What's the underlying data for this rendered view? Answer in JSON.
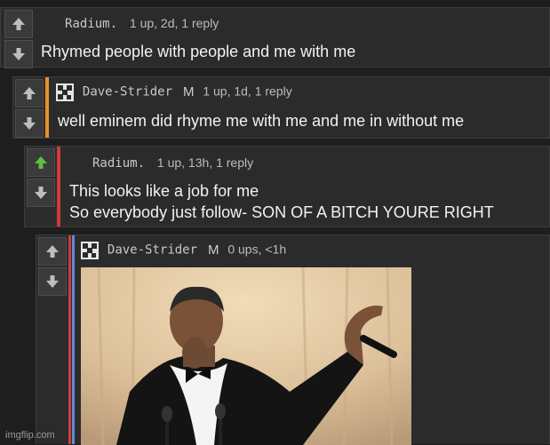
{
  "comments": [
    {
      "username": "Radium.",
      "mod_badge": "",
      "meta": "1 up, 2d, 1 reply",
      "lines": [
        "Rhymed people with people and me with me"
      ],
      "upvoted": false
    },
    {
      "username": "Dave-Strider",
      "mod_badge": "M",
      "meta": "1 up, 1d, 1 reply",
      "lines": [
        "well eminem did rhyme me with me and me in without me"
      ],
      "upvoted": false,
      "accent": "#e8912c"
    },
    {
      "username": "Radium.",
      "mod_badge": "",
      "meta": "1 up, 13h, 1 reply",
      "lines": [
        "This looks like a job for me",
        "So everybody just follow- SON OF A BITCH YOURE RIGHT"
      ],
      "upvoted": true,
      "accent": "#d23a3a"
    },
    {
      "username": "Dave-Strider",
      "mod_badge": "M",
      "meta": "0 ups, <1h",
      "lines": [],
      "upvoted": false,
      "accent": "#5a8fd6"
    }
  ],
  "watermark": "imgflip.com",
  "colors": {
    "upvote_active": "#5fbf3f",
    "arrow": "#bdbdbd"
  }
}
